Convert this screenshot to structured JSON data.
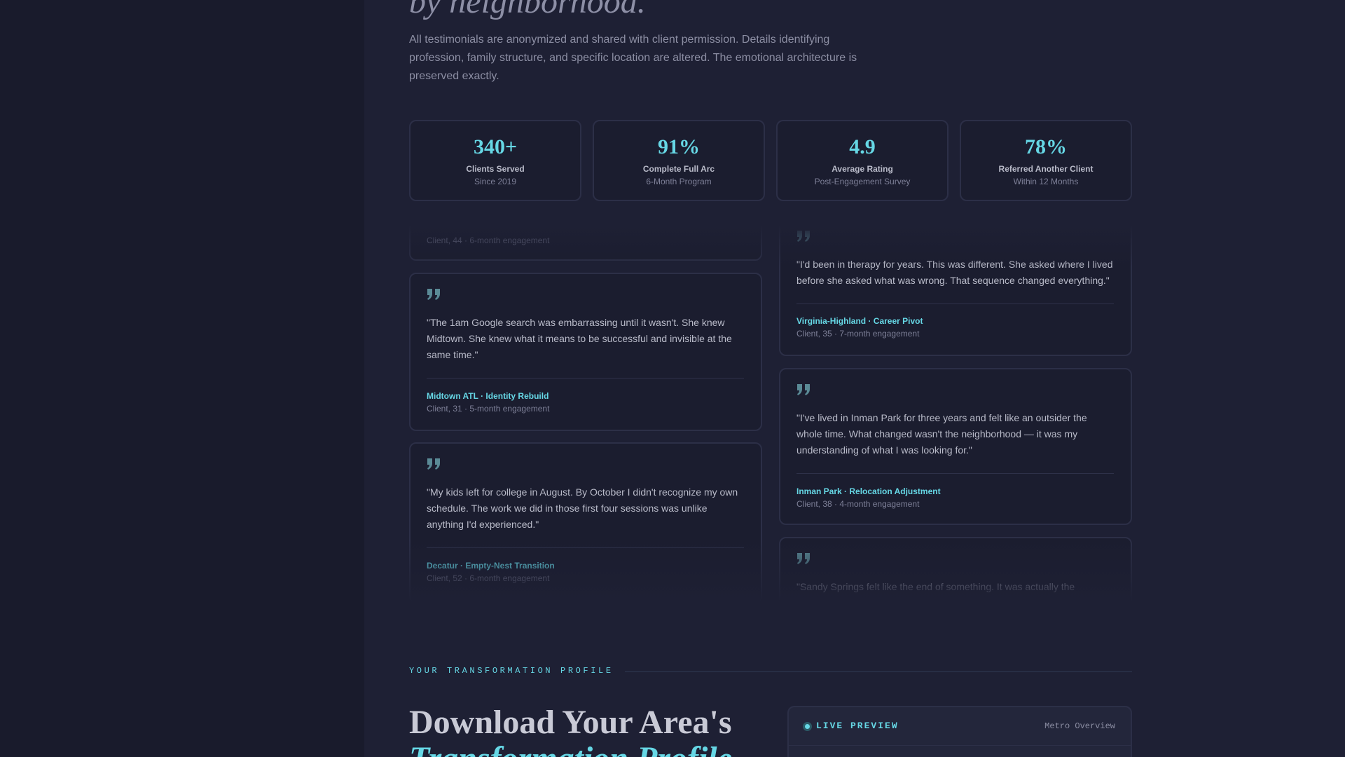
{
  "hero": {
    "title_fragment": "by neighborhood.",
    "intro": "All testimonials are anonymized and shared with client permission. Details identifying profession, family structure, and specific location are altered. The emotional architecture is preserved exactly."
  },
  "stats": [
    {
      "value": "340+",
      "label": "Clients Served",
      "sub": "Since 2019"
    },
    {
      "value": "91%",
      "label": "Complete Full Arc",
      "sub": "6-Month Program"
    },
    {
      "value": "4.9",
      "label": "Average Rating",
      "sub": "Post-Engagement Survey"
    },
    {
      "value": "78%",
      "label": "Referred Another Client",
      "sub": "Within 12 Months"
    }
  ],
  "testimonials": {
    "left": [
      {
        "meta": "Client, 44 · 6-month engagement"
      },
      {
        "quote": "\"The 1am Google search was embarrassing until it wasn't. She knew Midtown. She knew what it means to be successful and invisible at the same time.\"",
        "tag": "Midtown ATL · Identity Rebuild",
        "meta": "Client, 31 · 5-month engagement"
      },
      {
        "quote": "\"My kids left for college in August. By October I didn't recognize my own schedule. The work we did in those first four sessions was unlike anything I'd experienced.\"",
        "tag": "Decatur · Empty-Nest Transition",
        "meta": "Client, 52 · 6-month engagement"
      }
    ],
    "right": [
      {
        "quote": "\"I'd been in therapy for years. This was different. She asked where I lived before she asked what was wrong. That sequence changed everything.\"",
        "tag": "Virginia-Highland · Career Pivot",
        "meta": "Client, 35 · 7-month engagement"
      },
      {
        "quote": "\"I've lived in Inman Park for three years and felt like an outsider the whole time. What changed wasn't the neighborhood — it was my understanding of what I was looking for.\"",
        "tag": "Inman Park · Relocation Adjustment",
        "meta": "Client, 38 · 4-month engagement"
      },
      {
        "quote": "\"Sandy Springs felt like the end of something. It was actually the"
      }
    ]
  },
  "profile": {
    "eyebrow": "YOUR TRANSFORMATION PROFILE",
    "title_line1": "Download Your Area's",
    "title_line2": "Transformation Profile",
    "preview_label": "LIVE PREVIEW",
    "preview_meta": "Metro Overview"
  },
  "colors": {
    "background": "#1e2034",
    "card": "#1b1d2f",
    "accent": "#66d7e5",
    "text_muted": "#8c8ea3"
  }
}
